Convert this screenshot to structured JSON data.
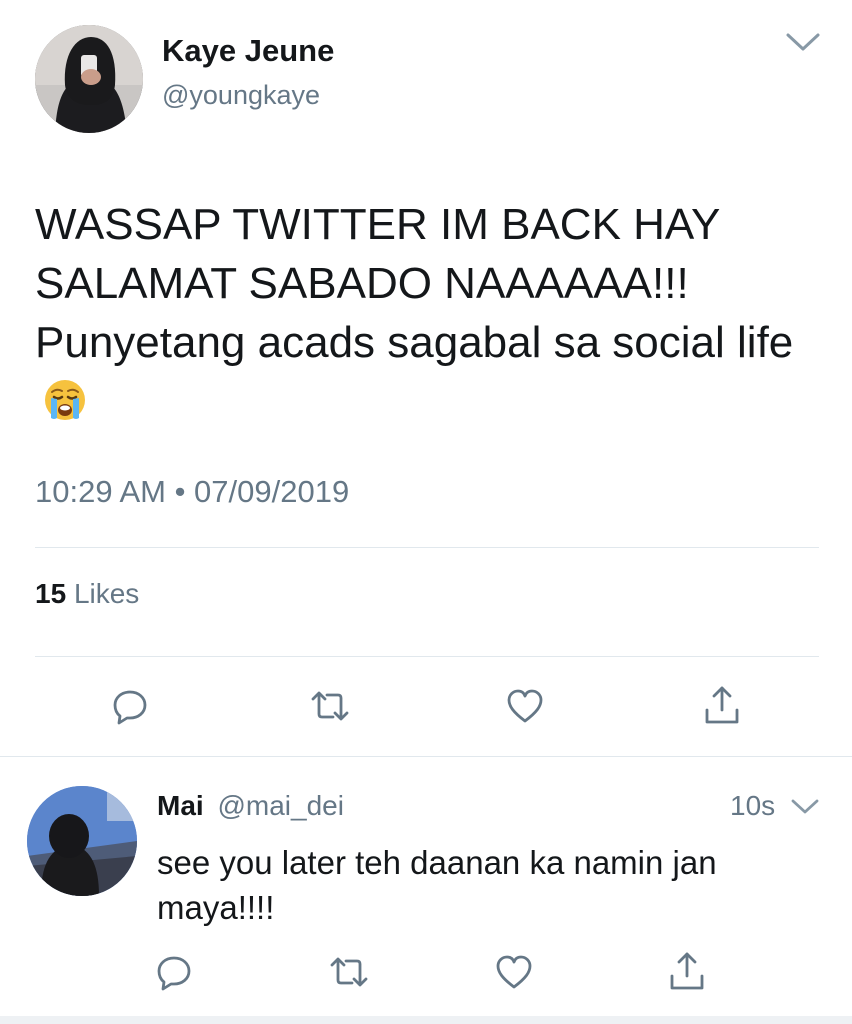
{
  "main_tweet": {
    "author_name": "Kaye Jeune",
    "author_handle": "@youngkaye",
    "text": "WASSAP TWITTER IM BACK HAY SALAMAT SABADO NAAAAAA!!! Punyetang acads sagabal sa social life",
    "emoji": "loudly-crying-face",
    "timestamp": "10:29 AM • 07/09/2019",
    "likes_count": "15",
    "likes_label": "Likes",
    "actions": [
      "reply-icon",
      "retweet-icon",
      "like-icon",
      "share-icon"
    ]
  },
  "reply": {
    "author_name": "Mai",
    "author_handle": "@mai_dei",
    "time": "10s",
    "text": "see you later teh daanan ka namin jan maya!!!!",
    "actions": [
      "reply-icon",
      "retweet-icon",
      "like-icon",
      "share-icon"
    ]
  },
  "colors": {
    "primary_text": "#14171a",
    "secondary_text": "#657786",
    "icon_gray": "#657786",
    "divider": "#e1e8ed"
  }
}
